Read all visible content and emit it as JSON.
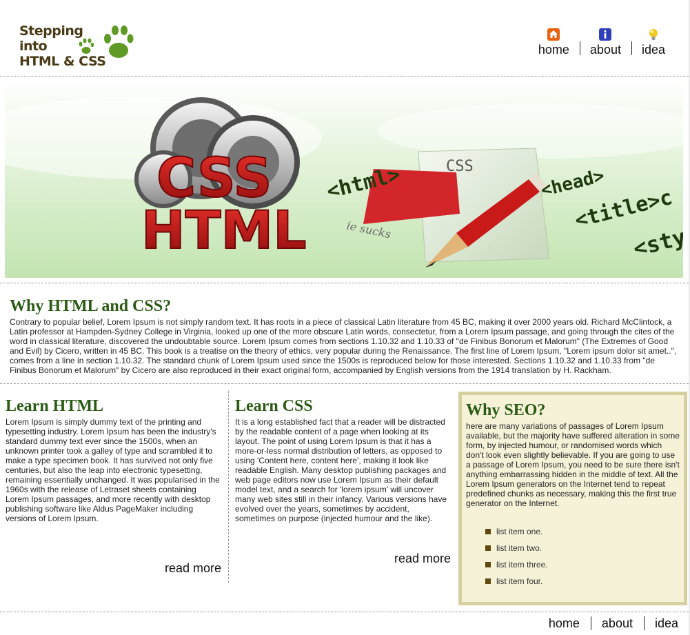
{
  "header": {
    "logo_lines": [
      "Stepping",
      "into",
      "HTML & CSS"
    ],
    "nav": [
      {
        "label": "home",
        "icon": "home-icon"
      },
      {
        "label": "about",
        "icon": "info-icon"
      },
      {
        "label": "idea",
        "icon": "lightbulb-icon"
      }
    ]
  },
  "hero": {
    "words": [
      "CSS",
      "HTML"
    ],
    "code_tags": [
      "<html>",
      "<head>",
      "<title>c",
      "<sty"
    ],
    "doc_label": "CSS",
    "doc_note": "ie sucks",
    "accent_red": "#cc1f1f",
    "accent_green": "#1f3a0e"
  },
  "intro": {
    "title": "Why HTML and CSS?",
    "text": "Contrary to popular belief, Lorem Ipsum is not simply random text. It has roots in a piece of classical Latin literature from 45 BC, making it over 2000 years old. Richard McClintock, a Latin professor at Hampden-Sydney College in Virginia, looked up one of the more obscure Latin words, consectetur, from a Lorem Ipsum passage, and going through the cites of the word in classical literature, discovered the undoubtable source. Lorem Ipsum comes from sections 1.10.32 and 1.10.33 of \"de Finibus Bonorum et Malorum\" (The Extremes of Good and Evil) by Cicero, written in 45 BC. This book is a treatise on the theory of ethics, very popular during the Renaissance. The first line of Lorem Ipsum, \"Lorem ipsum dolor sit amet..\", comes from a line in section 1.10.32. The standard chunk of Lorem Ipsum used since the 1500s is reproduced below for those interested. Sections 1.10.32 and 1.10.33 from \"de Finibus Bonorum et Malorum\" by Cicero are also reproduced in their exact original form, accompanied by English versions from the 1914 translation by H. Rackham."
  },
  "learn_html": {
    "title": "Learn HTML",
    "text": "Lorem Ipsum is simply dummy text of the printing and typesetting industry. Lorem Ipsum has been the industry's standard dummy text ever since the 1500s, when an unknown printer took a galley of type and scrambled it to make a type specimen book. It has survived not only five centuries, but also the leap into electronic typesetting, remaining essentially unchanged. It was popularised in the 1960s with the release of Letraset sheets containing Lorem Ipsum passages, and more recently with desktop publishing software like Aldus PageMaker including versions of Lorem Ipsum.",
    "read_more": "read more"
  },
  "learn_css": {
    "title": "Learn CSS",
    "text": "It is a long established fact that a reader will be distracted by the readable content of a page when looking at its layout. The point of using Lorem Ipsum is that it has a more-or-less normal distribution of letters, as opposed to using 'Content here, content here', making it look like readable English. Many desktop publishing packages and web page editors now use Lorem Ipsum as their default model text, and a search for 'lorem ipsum' will uncover many web sites still in their infancy. Various versions have evolved over the years, sometimes by accident, sometimes on purpose (injected humour and the like).",
    "read_more": "read more"
  },
  "seo": {
    "title": "Why SEO?",
    "text": "here are many variations of passages of Lorem Ipsum available, but the majority have suffered alteration in some form, by injected humour, or randomised words which don't look even slightly believable. If you are going to use a passage of Lorem Ipsum, you need to be sure there isn't anything embarrassing hidden in the middle of text. All the Lorem Ipsum generators on the Internet tend to repeat predefined chunks as necessary, making this the first true generator on the Internet.",
    "items": [
      "list item one.",
      "list item two.",
      "list item three.",
      "list item four."
    ]
  },
  "footer": {
    "nav": [
      "home",
      "about",
      "idea"
    ]
  },
  "colors": {
    "heading_green": "#2a5a14",
    "seo_bg": "#f5f2d8",
    "seo_border": "#d6d0a0",
    "bullet": "#5e4a10"
  }
}
